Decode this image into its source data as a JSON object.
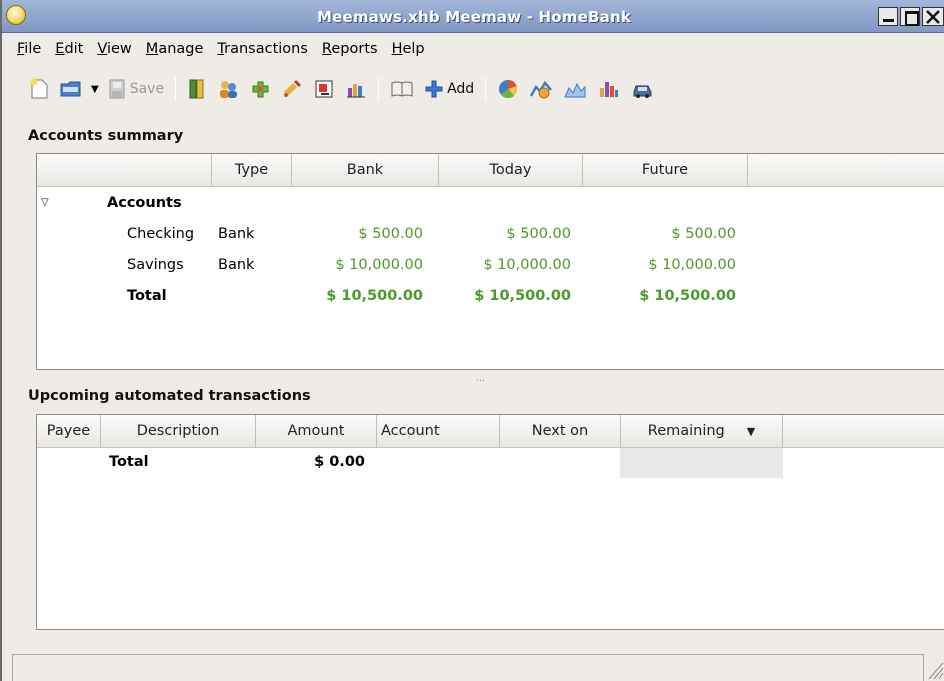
{
  "window": {
    "title": "Meemaws.xhb Meemaw - HomeBank"
  },
  "menubar": [
    {
      "label": "File",
      "accel": "F",
      "rest": "ile"
    },
    {
      "label": "Edit",
      "accel": "E",
      "rest": "dit"
    },
    {
      "label": "View",
      "accel": "V",
      "rest": "iew"
    },
    {
      "label": "Manage",
      "accel": "M",
      "rest": "anage"
    },
    {
      "label": "Transactions",
      "accel": "T",
      "rest": "ransactions"
    },
    {
      "label": "Reports",
      "accel": "R",
      "rest": "eports"
    },
    {
      "label": "Help",
      "accel": "H",
      "rest": "elp"
    }
  ],
  "toolbar": {
    "save_label": "Save",
    "add_label": "Add"
  },
  "accounts": {
    "section_title": "Accounts summary",
    "columns": [
      "",
      "Type",
      "Bank",
      "Today",
      "Future"
    ],
    "group_label": "Accounts",
    "rows": [
      {
        "name": "Checking",
        "type": "Bank",
        "bank": "$ 500.00",
        "today": "$ 500.00",
        "future": "$ 500.00"
      },
      {
        "name": "Savings",
        "type": "Bank",
        "bank": "$ 10,000.00",
        "today": "$ 10,000.00",
        "future": "$ 10,000.00"
      }
    ],
    "total": {
      "label": "Total",
      "bank": "$ 10,500.00",
      "today": "$ 10,500.00",
      "future": "$ 10,500.00"
    }
  },
  "upcoming": {
    "section_title": "Upcoming automated transactions",
    "columns": [
      "Payee",
      "Description",
      "Amount",
      "Account",
      "Next on",
      "Remaining"
    ],
    "total": {
      "label": "Total",
      "amount": "$ 0.00"
    }
  },
  "pane_grip": "…"
}
